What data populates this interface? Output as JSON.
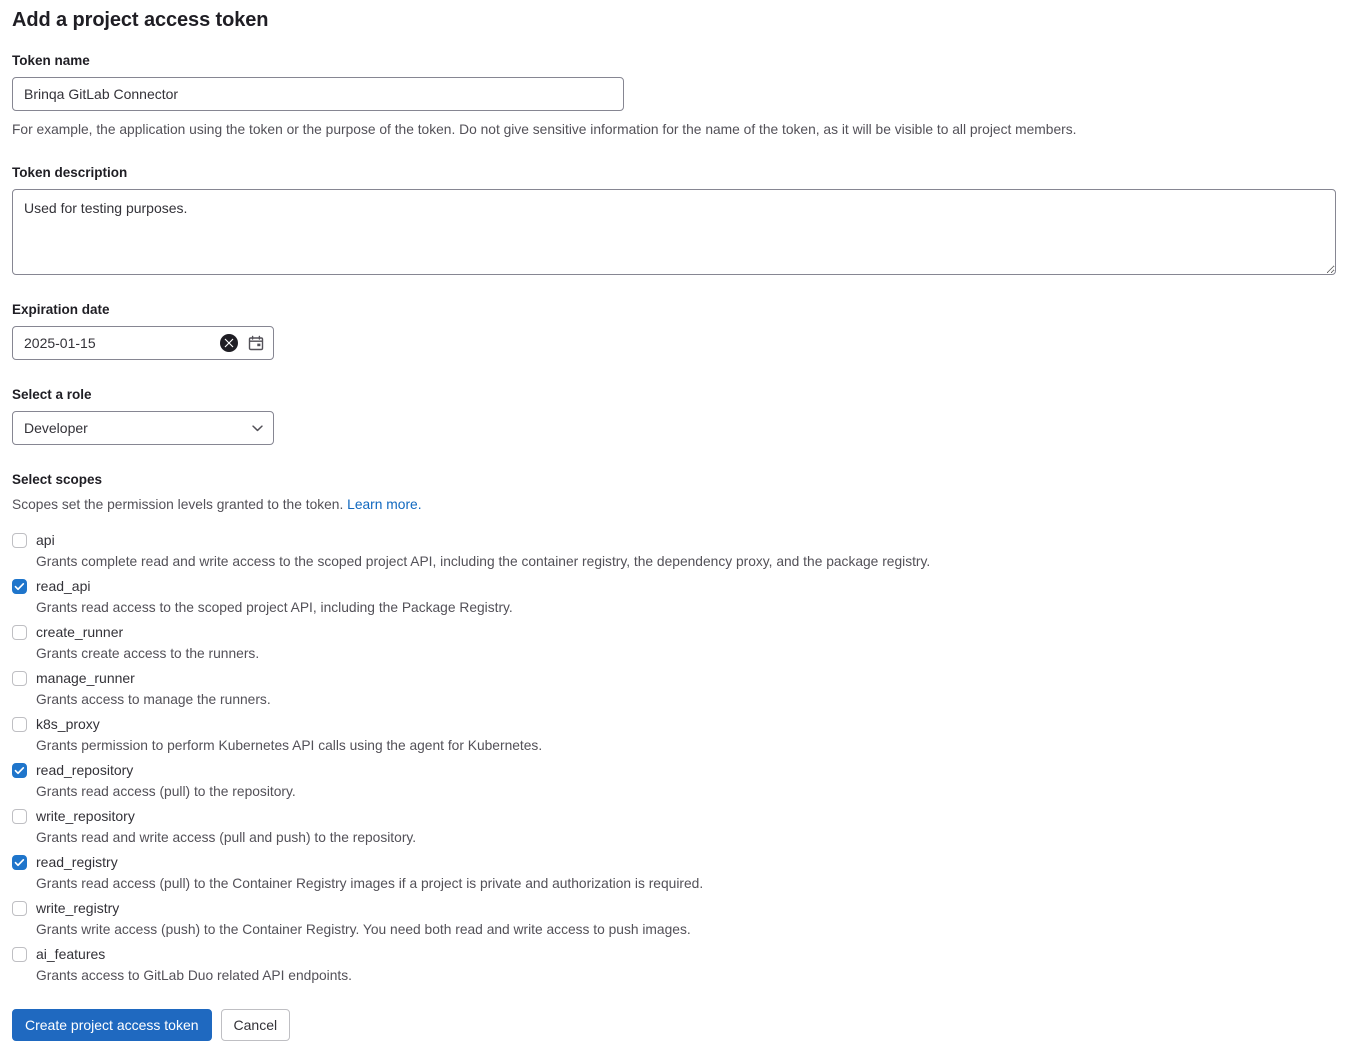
{
  "page": {
    "title": "Add a project access token"
  },
  "token_name": {
    "label": "Token name",
    "value": "Brinqa GitLab Connector",
    "placeholder": "",
    "help": "For example, the application using the token or the purpose of the token. Do not give sensitive information for the name of the token, as it will be visible to all project members."
  },
  "token_description": {
    "label": "Token description",
    "value": "Used for testing purposes.",
    "placeholder": ""
  },
  "expiration": {
    "label": "Expiration date",
    "value": "2025-01-15",
    "clear_icon": "clear-circle-icon",
    "calendar_icon": "calendar-icon"
  },
  "role": {
    "label": "Select a role",
    "selected": "Developer",
    "options": [
      "Developer"
    ],
    "caret_icon": "chevron-down-icon"
  },
  "scopes": {
    "label": "Select scopes",
    "help_prefix": "Scopes set the permission levels granted to the token. ",
    "learn_more": "Learn more.",
    "items": [
      {
        "name": "api",
        "checked": false,
        "description": "Grants complete read and write access to the scoped project API, including the container registry, the dependency proxy, and the package registry."
      },
      {
        "name": "read_api",
        "checked": true,
        "description": "Grants read access to the scoped project API, including the Package Registry."
      },
      {
        "name": "create_runner",
        "checked": false,
        "description": "Grants create access to the runners."
      },
      {
        "name": "manage_runner",
        "checked": false,
        "description": "Grants access to manage the runners."
      },
      {
        "name": "k8s_proxy",
        "checked": false,
        "description": "Grants permission to perform Kubernetes API calls using the agent for Kubernetes."
      },
      {
        "name": "read_repository",
        "checked": true,
        "description": "Grants read access (pull) to the repository."
      },
      {
        "name": "write_repository",
        "checked": false,
        "description": "Grants read and write access (pull and push) to the repository."
      },
      {
        "name": "read_registry",
        "checked": true,
        "description": "Grants read access (pull) to the Container Registry images if a project is private and authorization is required."
      },
      {
        "name": "write_registry",
        "checked": false,
        "description": "Grants write access (push) to the Container Registry. You need both read and write access to push images."
      },
      {
        "name": "ai_features",
        "checked": false,
        "description": "Grants access to GitLab Duo related API endpoints."
      }
    ]
  },
  "actions": {
    "submit_label": "Create project access token",
    "cancel_label": "Cancel"
  },
  "colors": {
    "primary_button": "#1f69c0",
    "checkbox_checked": "#1f75cb",
    "link": "#1068bf"
  }
}
